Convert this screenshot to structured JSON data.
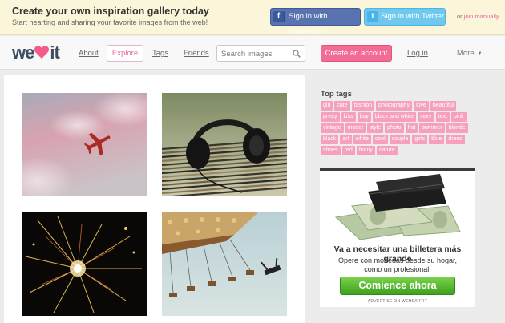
{
  "banner": {
    "title": "Create your own inspiration gallery today",
    "subtitle": "Start hearting and sharing your favorite images from the web!",
    "facebook_button": "Sign in with Facebook",
    "twitter_button": "Sign in with Twitter",
    "or_text": "or",
    "join_link": "join manually"
  },
  "nav": {
    "logo_left": "we",
    "logo_right": "it",
    "about": "About",
    "explore": "Explore",
    "tags": "Tags",
    "friends": "Friends",
    "search_placeholder": "Search images",
    "create_account": "Create an account",
    "login": "Log in",
    "more": "More",
    "more_chevron": "▼"
  },
  "gallery": {
    "photos": [
      {
        "name": "airplane-sky-photo"
      },
      {
        "name": "headphones-records-photo"
      },
      {
        "name": "sparklers-photo"
      },
      {
        "name": "swing-carousel-photo"
      }
    ]
  },
  "sidebar": {
    "tags_title": "Top tags",
    "tags": [
      "girl",
      "cute",
      "fashion",
      "photography",
      "love",
      "beautiful",
      "pretty",
      "kiss",
      "boy",
      "black and white",
      "sexy",
      "text",
      "pink",
      "vintage",
      "model",
      "style",
      "photo",
      "hot",
      "summer",
      "blonde",
      "black",
      "art",
      "white",
      "cool",
      "couple",
      "girls",
      "blue",
      "dress",
      "shoes",
      "red",
      "funny",
      "nature"
    ],
    "ad": {
      "headline": "Va a necesitar una billetera más grande",
      "body": "Opere con monedas desde su hogar, como un profesional.",
      "cta": "Comience ahora",
      "footer": "ADVERTISE ON WEHEARTIT"
    }
  },
  "colors": {
    "accent_pink": "#f26c95",
    "tag_pink": "#f6a0bd",
    "facebook_blue": "#5873b0",
    "twitter_blue": "#70c8ee",
    "banner_bg": "#fbf5d9",
    "cta_green": "#3ea11e"
  }
}
